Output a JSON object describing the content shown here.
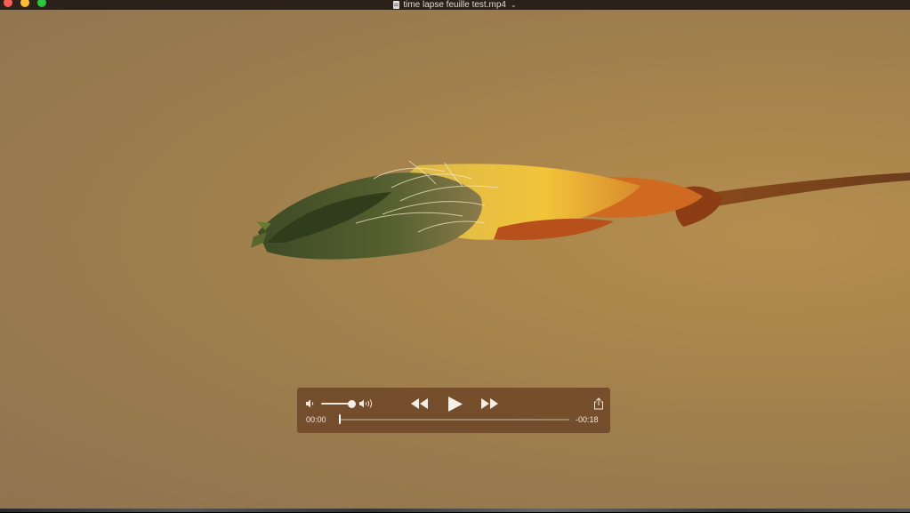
{
  "window": {
    "title": "time lapse feuille test.mp4",
    "title_chevron": "⌄"
  },
  "player": {
    "current_time": "00:00",
    "remaining_time": "-00:18",
    "progress": 0.0,
    "volume": 0.9
  }
}
